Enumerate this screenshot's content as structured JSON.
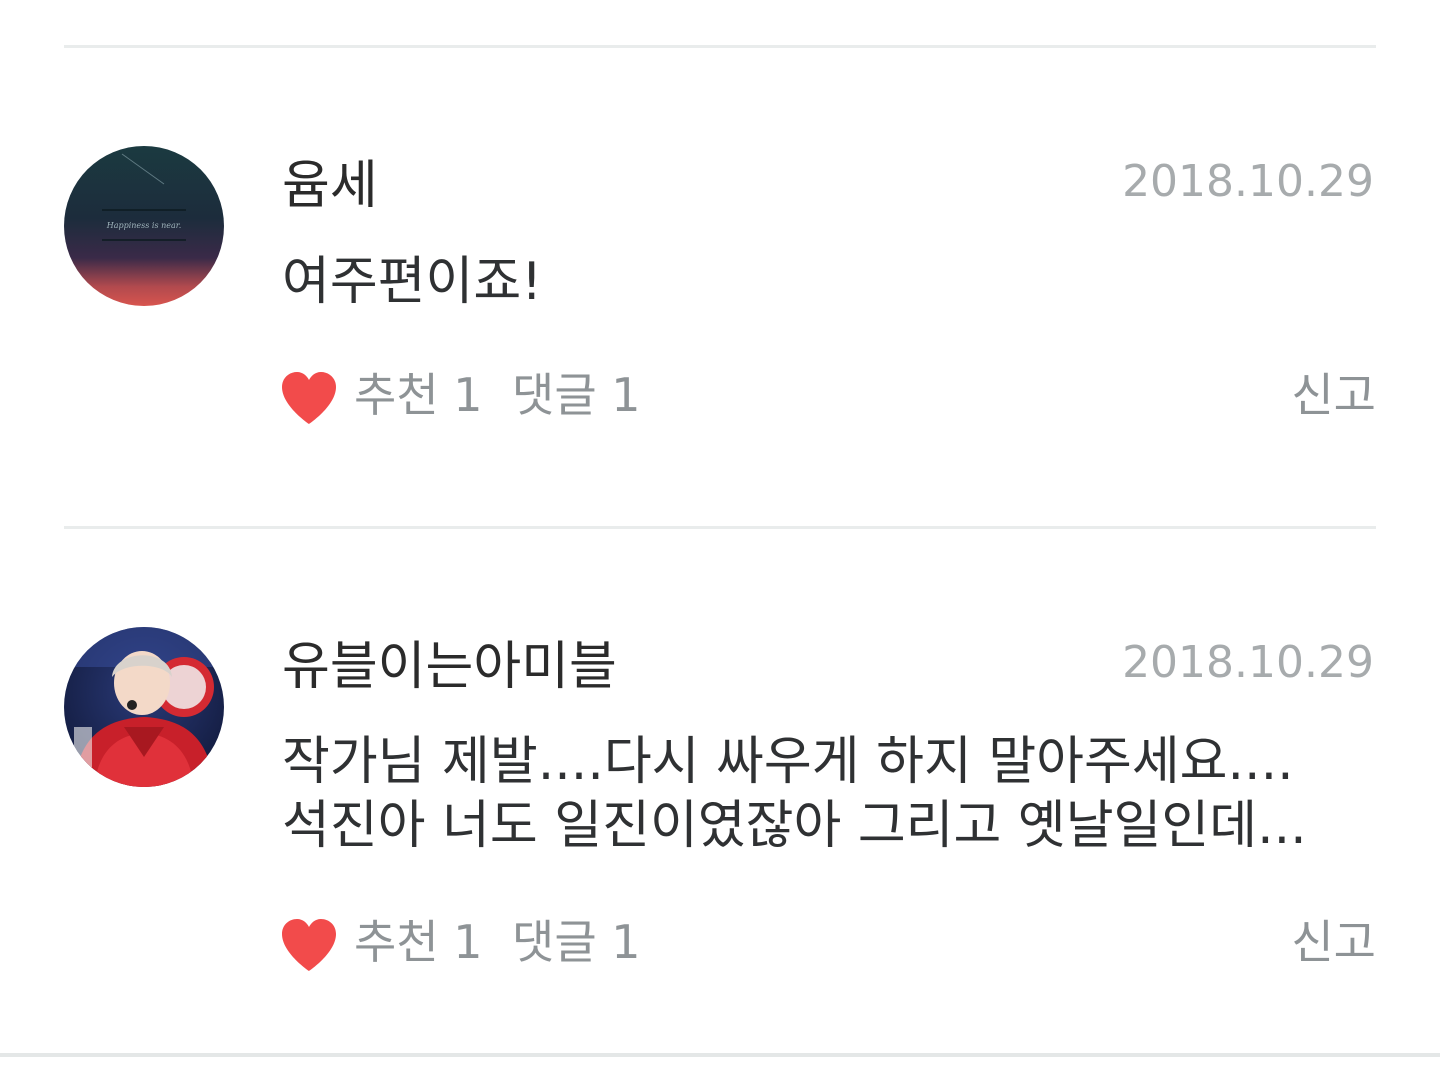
{
  "colors": {
    "heart": "#f24b4b",
    "divider": "#e9ecec",
    "date": "#a7abad",
    "action_text": "#8e9396",
    "text": "#2f3133"
  },
  "comments": [
    {
      "username": "윰세",
      "date": "2018.10.29",
      "lines": [
        "여주편이죠!"
      ],
      "like_label": "추천 1",
      "reply_label": "댓글 1",
      "report_label": "신고",
      "avatar_icon": "night-sky-avatar",
      "avatar_caption": "Happiness is near."
    },
    {
      "username": "유블이는아미블",
      "date": "2018.10.29",
      "lines": [
        "작가님 제발....다시 싸우게 하지 말아주세요....",
        "석진아 너도 일진이였잖아 그리고 옛날일인데..."
      ],
      "like_label": "추천 1",
      "reply_label": "댓글 1",
      "report_label": "신고",
      "avatar_icon": "person-in-red-avatar"
    }
  ]
}
